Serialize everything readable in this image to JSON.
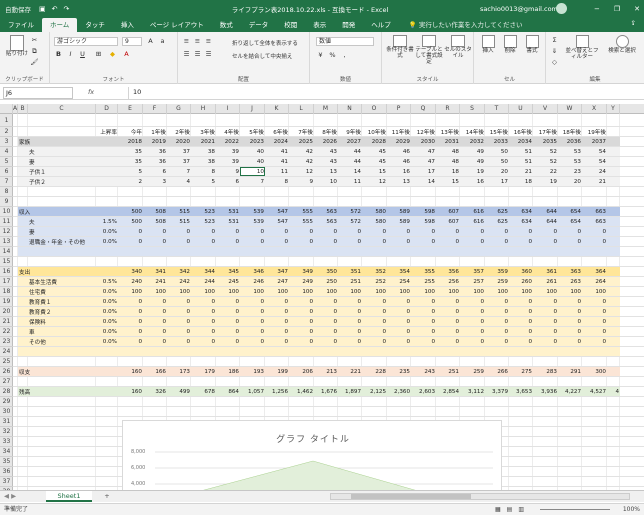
{
  "window": {
    "autosave": "自動保存",
    "title": "ライフプラン表2018.10.22.xls  -  互換モード  -  Excel",
    "account": "sachio0013@gmail.com",
    "controls": [
      "−",
      "❐",
      "✕"
    ]
  },
  "tabs": [
    "ファイル",
    "ホーム",
    "タッチ",
    "挿入",
    "ページ レイアウト",
    "数式",
    "データ",
    "校閲",
    "表示",
    "開発",
    "ヘルプ"
  ],
  "active_tab": "ホーム",
  "tell_me": "実行したい作業を入力してください",
  "ribbon": {
    "groups": {
      "clipboard": "クリップボード",
      "font": "フォント",
      "alignment": "配置",
      "number": "数値",
      "styles": "スタイル",
      "cells": "セル",
      "editing": "編集"
    },
    "font_name": "游ゴシック",
    "font_size": "9",
    "number_format": "数値",
    "wrap_text": "折り返して全体を表示する",
    "merge_center": "セルを結合して中央揃え",
    "paste": "貼り付け",
    "cond_format": "条件付き書式",
    "table_format": "テーブルとして書式設定",
    "cell_styles": "セルのスタイル",
    "insert": "挿入",
    "delete": "削除",
    "format": "書式",
    "sort_filter": "並べ替えとフィルター",
    "find_select": "検索と選択",
    "bold": "B",
    "italic": "I",
    "underline": "U"
  },
  "formula_bar": {
    "name_box": "J6",
    "fx": "fx",
    "value": "10"
  },
  "columns": [
    {
      "l": "A",
      "w": 5
    },
    {
      "l": "B",
      "w": 10
    },
    {
      "l": "C",
      "w": 68
    },
    {
      "l": "D",
      "w": 22
    },
    {
      "l": "E",
      "w": 25
    },
    {
      "l": "F",
      "w": 24
    },
    {
      "l": "G",
      "w": 24
    },
    {
      "l": "H",
      "w": 25
    },
    {
      "l": "I",
      "w": 24
    },
    {
      "l": "J",
      "w": 25
    },
    {
      "l": "K",
      "w": 24
    },
    {
      "l": "L",
      "w": 25
    },
    {
      "l": "M",
      "w": 24
    },
    {
      "l": "N",
      "w": 24
    },
    {
      "l": "O",
      "w": 25
    },
    {
      "l": "P",
      "w": 24
    },
    {
      "l": "Q",
      "w": 25
    },
    {
      "l": "R",
      "w": 24
    },
    {
      "l": "S",
      "w": 25
    },
    {
      "l": "T",
      "w": 24
    },
    {
      "l": "U",
      "w": 24
    },
    {
      "l": "V",
      "w": 25
    },
    {
      "l": "W",
      "w": 24
    },
    {
      "l": "X",
      "w": 25
    },
    {
      "l": "Y",
      "w": 13
    }
  ],
  "rows": [
    {
      "n": "1",
      "h": 13
    },
    {
      "n": "2",
      "h": 10,
      "D": "上昇率",
      "vals": [
        "今年",
        "1年後",
        "2年後",
        "3年後",
        "4年後",
        "5年後",
        "6年後",
        "7年後",
        "8年後",
        "9年後",
        "10年後",
        "11年後",
        "12年後",
        "13年後",
        "14年後",
        "15年後",
        "16年後",
        "17年後",
        "18年後",
        "19年後",
        ""
      ]
    },
    {
      "n": "3",
      "h": 10,
      "bg": "#d9d9d9",
      "B": "家族",
      "vals": [
        "2018",
        "2019",
        "2020",
        "2021",
        "2022",
        "2023",
        "2024",
        "2025",
        "2026",
        "2027",
        "2028",
        "2029",
        "2030",
        "2031",
        "2032",
        "2033",
        "2034",
        "2035",
        "2036",
        "2037",
        ""
      ]
    },
    {
      "n": "4",
      "h": 10,
      "bg": "#f2f2f2",
      "C": "夫",
      "vals": [
        "35",
        "36",
        "37",
        "38",
        "39",
        "40",
        "41",
        "42",
        "43",
        "44",
        "45",
        "46",
        "47",
        "48",
        "49",
        "50",
        "51",
        "52",
        "53",
        "54",
        ""
      ]
    },
    {
      "n": "5",
      "h": 10,
      "bg": "#f2f2f2",
      "C": "妻",
      "vals": [
        "35",
        "36",
        "37",
        "38",
        "39",
        "40",
        "41",
        "42",
        "43",
        "44",
        "45",
        "46",
        "47",
        "48",
        "49",
        "50",
        "51",
        "52",
        "53",
        "54",
        ""
      ]
    },
    {
      "n": "6",
      "h": 10,
      "bg": "#f2f2f2",
      "C": "子供１",
      "vals": [
        "5",
        "6",
        "7",
        "8",
        "9",
        "10",
        "11",
        "12",
        "13",
        "14",
        "15",
        "16",
        "17",
        "18",
        "19",
        "20",
        "21",
        "22",
        "23",
        "24",
        ""
      ]
    },
    {
      "n": "7",
      "h": 10,
      "bg": "#f2f2f2",
      "C": "子供２",
      "vals": [
        "2",
        "3",
        "4",
        "5",
        "6",
        "7",
        "8",
        "9",
        "10",
        "11",
        "12",
        "13",
        "14",
        "15",
        "16",
        "17",
        "18",
        "19",
        "20",
        "21",
        ""
      ]
    },
    {
      "n": "8",
      "h": 10
    },
    {
      "n": "9",
      "h": 10
    },
    {
      "n": "10",
      "h": 10,
      "bg": "#b4c6e7",
      "B": "収入",
      "vals": [
        "500",
        "508",
        "515",
        "523",
        "531",
        "539",
        "547",
        "555",
        "563",
        "572",
        "580",
        "589",
        "598",
        "607",
        "616",
        "625",
        "634",
        "644",
        "654",
        "663",
        ""
      ]
    },
    {
      "n": "11",
      "h": 10,
      "bg": "#dae3f3",
      "C": "夫",
      "D": "1.5%",
      "vals": [
        "500",
        "508",
        "515",
        "523",
        "531",
        "539",
        "547",
        "555",
        "563",
        "572",
        "580",
        "589",
        "598",
        "607",
        "616",
        "625",
        "634",
        "644",
        "654",
        "663",
        ""
      ]
    },
    {
      "n": "12",
      "h": 10,
      "bg": "#dae3f3",
      "C": "妻",
      "D": "0.0%",
      "vals": [
        "0",
        "0",
        "0",
        "0",
        "0",
        "0",
        "0",
        "0",
        "0",
        "0",
        "0",
        "0",
        "0",
        "0",
        "0",
        "0",
        "0",
        "0",
        "0",
        "0",
        ""
      ]
    },
    {
      "n": "13",
      "h": 10,
      "bg": "#dae3f3",
      "C": "退職金・年金・その他",
      "D": "0.0%",
      "vals": [
        "0",
        "0",
        "0",
        "0",
        "0",
        "0",
        "0",
        "0",
        "0",
        "0",
        "0",
        "0",
        "0",
        "0",
        "0",
        "0",
        "0",
        "0",
        "0",
        "0",
        ""
      ]
    },
    {
      "n": "14",
      "h": 10,
      "bg": "#dae3f3"
    },
    {
      "n": "15",
      "h": 10
    },
    {
      "n": "16",
      "h": 10,
      "bg": "#ffe699",
      "B": "支出",
      "vals": [
        "340",
        "341",
        "342",
        "344",
        "345",
        "346",
        "347",
        "349",
        "350",
        "351",
        "352",
        "354",
        "355",
        "356",
        "357",
        "359",
        "360",
        "361",
        "363",
        "364",
        ""
      ]
    },
    {
      "n": "17",
      "h": 10,
      "bg": "#fff2cc",
      "C": "基本生活費",
      "D": "0.5%",
      "vals": [
        "240",
        "241",
        "242",
        "244",
        "245",
        "246",
        "247",
        "249",
        "250",
        "251",
        "252",
        "254",
        "255",
        "256",
        "257",
        "259",
        "260",
        "261",
        "263",
        "264",
        ""
      ]
    },
    {
      "n": "18",
      "h": 10,
      "bg": "#fff2cc",
      "C": "住宅費",
      "D": "0.0%",
      "vals": [
        "100",
        "100",
        "100",
        "100",
        "100",
        "100",
        "100",
        "100",
        "100",
        "100",
        "100",
        "100",
        "100",
        "100",
        "100",
        "100",
        "100",
        "100",
        "100",
        "100",
        ""
      ]
    },
    {
      "n": "19",
      "h": 10,
      "bg": "#fff2cc",
      "C": "教育費１",
      "D": "0.0%",
      "vals": [
        "0",
        "0",
        "0",
        "0",
        "0",
        "0",
        "0",
        "0",
        "0",
        "0",
        "0",
        "0",
        "0",
        "0",
        "0",
        "0",
        "0",
        "0",
        "0",
        "0",
        ""
      ]
    },
    {
      "n": "20",
      "h": 10,
      "bg": "#fff2cc",
      "C": "教育費２",
      "D": "0.0%",
      "vals": [
        "0",
        "0",
        "0",
        "0",
        "0",
        "0",
        "0",
        "0",
        "0",
        "0",
        "0",
        "0",
        "0",
        "0",
        "0",
        "0",
        "0",
        "0",
        "0",
        "0",
        ""
      ]
    },
    {
      "n": "21",
      "h": 10,
      "bg": "#fff2cc",
      "C": "保険料",
      "D": "0.0%",
      "vals": [
        "0",
        "0",
        "0",
        "0",
        "0",
        "0",
        "0",
        "0",
        "0",
        "0",
        "0",
        "0",
        "0",
        "0",
        "0",
        "0",
        "0",
        "0",
        "0",
        "0",
        ""
      ]
    },
    {
      "n": "22",
      "h": 10,
      "bg": "#fff2cc",
      "C": "車",
      "D": "0.0%",
      "vals": [
        "0",
        "0",
        "0",
        "0",
        "0",
        "0",
        "0",
        "0",
        "0",
        "0",
        "0",
        "0",
        "0",
        "0",
        "0",
        "0",
        "0",
        "0",
        "0",
        "0",
        ""
      ]
    },
    {
      "n": "23",
      "h": 10,
      "bg": "#fff2cc",
      "C": "その他",
      "D": "0.0%",
      "vals": [
        "0",
        "0",
        "0",
        "0",
        "0",
        "0",
        "0",
        "0",
        "0",
        "0",
        "0",
        "0",
        "0",
        "0",
        "0",
        "0",
        "0",
        "0",
        "0",
        "0",
        ""
      ]
    },
    {
      "n": "24",
      "h": 10,
      "bg": "#fff2cc"
    },
    {
      "n": "25",
      "h": 10
    },
    {
      "n": "26",
      "h": 10,
      "bg": "#fbe5d6",
      "B": "収支",
      "vals": [
        "160",
        "166",
        "173",
        "179",
        "186",
        "193",
        "199",
        "206",
        "213",
        "221",
        "228",
        "235",
        "243",
        "251",
        "259",
        "266",
        "275",
        "283",
        "291",
        "300",
        ""
      ]
    },
    {
      "n": "27",
      "h": 10
    },
    {
      "n": "28",
      "h": 10,
      "bg": "#e2efda",
      "B": "残高",
      "vals": [
        "160",
        "326",
        "499",
        "678",
        "864",
        "1,057",
        "1,256",
        "1,462",
        "1,676",
        "1,897",
        "2,125",
        "2,360",
        "2,603",
        "2,854",
        "3,112",
        "3,379",
        "3,653",
        "3,936",
        "4,227",
        "4,527",
        "4"
      ]
    },
    {
      "n": "29",
      "h": 10
    },
    {
      "n": "30",
      "h": 10
    },
    {
      "n": "31",
      "h": 10
    },
    {
      "n": "32",
      "h": 10
    },
    {
      "n": "33",
      "h": 10
    },
    {
      "n": "34",
      "h": 10
    },
    {
      "n": "35",
      "h": 10
    },
    {
      "n": "36",
      "h": 10
    },
    {
      "n": "37",
      "h": 10
    },
    {
      "n": "38",
      "h": 10
    }
  ],
  "selected_cell": {
    "row": "6",
    "col": "J"
  },
  "chart": {
    "title": "グラフ タイトル",
    "y_labels": [
      "8,000",
      "6,000",
      "4,000"
    ]
  },
  "sheet_tab": "Sheet1",
  "add_sheet": "+",
  "status": {
    "ready": "準備完了",
    "zoom": "100%"
  },
  "colors": {
    "excel_green": "#217346"
  }
}
